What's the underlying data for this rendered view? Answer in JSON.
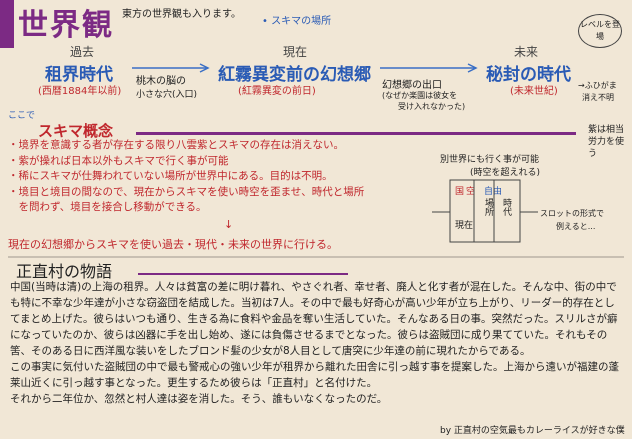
{
  "header": {
    "title": "世界観",
    "note_top": "東方の世界観も入ります。",
    "sukima_place": "• スキマの場所"
  },
  "timeline": {
    "past": {
      "label": "過去",
      "name": "租界時代",
      "sub": "(西暦1884年以前)"
    },
    "present": {
      "label": "現在",
      "name": "紅霧異変前の幻想郷",
      "sub": "(紅霧異変の前日)"
    },
    "future": {
      "label": "未来",
      "name": "秘封の時代",
      "sub": "(未来世紀)"
    },
    "note_past_1": "桃木の脳の",
    "note_past_2": "小さな穴(入口)",
    "note_present_1": "幻想郷の出口",
    "note_present_2": "(なぜか楽園は彼女を",
    "note_present_3": "受け入れなかった)",
    "note_future_1": "→ふひがま",
    "note_future_2": "消え不明",
    "note_level": "レベルを登場"
  },
  "sukima": {
    "prefix": "ここで",
    "title": "スキマ概念",
    "items": [
      "・境界を意識する者が存在する限り八雲紫とスキマの存在は消えない。",
      "・紫が操れば日本以外もスキマで行く事が可能",
      "・稀にスキマが仕舞われていない場所が世界中にある。目的は不明。",
      "・境目と境目の間なので、現在からスキマを使い時空を歪ませ、時代と場所",
      "　を問わず、境目を接合し移動ができる。"
    ],
    "arrow": "↓",
    "conclusion": "現在の幻想郷からスキマを使い過去・現代・未来の世界に行ける。",
    "side_note_1": "紫は相当",
    "side_note_2": "労力を使う",
    "diagram_note_1": "別世界にも行く事が可能",
    "diagram_note_2": "(時空を超えれる)",
    "diagram_labels": [
      "国",
      "空",
      "自由",
      "過去",
      "現在",
      "未来",
      "時代",
      "場所"
    ],
    "slot_note_1": "スロットの形式で",
    "slot_note_2": "例えると..."
  },
  "story": {
    "title": "正直村の物語",
    "paragraphs": [
      "中国(当時は清)の上海の租界。人々は貧富の差に明け暮れ、やさぐれ者、幸せ者、廃人と化す者が混在した。そんな中、街の中でも特に不幸な少年達が小さな窃盗団を結成した。当初は7人。その中で最も好奇心が高い少年が立ち上がり、リーダー的存在としてまとめ上げた。彼らはいつも通り、生きる為に食料や金品を奪い生活していた。そんなある日の事。突然だった。スリルさが癖になっていたのか、彼らは凶器に手を出し始め、遂には負傷させるまでとなった。彼らは盗賊団に成り果てていた。それもその筈、そのある日に西洋風な装いをしたブロンド髪の少女が8人目として唐突に少年達の前に現れたからである。",
      "この事実に気付いた盗賊団の中で最も警戒心の強い少年が租界から離れた田舎に引っ越す事を提案した。上海から遠いが福建の蓬莱山近くに引っ越す事となった。更生するため彼らは「正直村」と名付けた。",
      "それから二年位か、忽然と村人達は姿を消した。そう、誰もいなくなったのだ。"
    ],
    "footer": "by 正直村の空気最もカレーライスが好きな僕"
  }
}
